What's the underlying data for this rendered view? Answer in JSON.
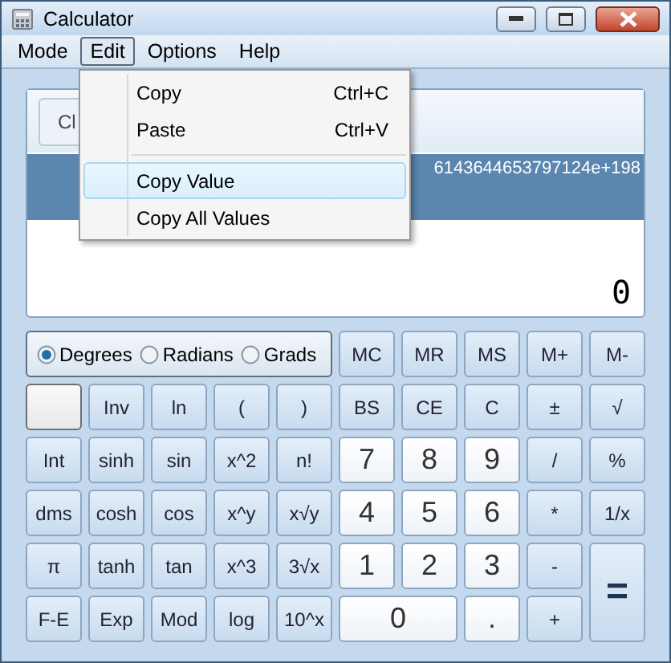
{
  "window": {
    "title": "Calculator"
  },
  "menu": [
    {
      "label": "Mode",
      "selected": false
    },
    {
      "label": "Edit",
      "selected": true
    },
    {
      "label": "Options",
      "selected": false
    },
    {
      "label": "Help",
      "selected": false
    }
  ],
  "dropdown": [
    {
      "label": "Copy",
      "shortcut": "Ctrl+C",
      "selected": false,
      "separator_after": false
    },
    {
      "label": "Paste",
      "shortcut": "Ctrl+V",
      "selected": false,
      "separator_after": true
    },
    {
      "label": "Copy Value",
      "selected": true,
      "separator_after": false
    },
    {
      "label": "Copy All Values",
      "selected": false,
      "separator_after": false
    }
  ],
  "display": {
    "clear_button": "Cl",
    "history": "6143644653797124e+198",
    "result": "0"
  },
  "angle_units": [
    {
      "label": "Degrees",
      "selected": true
    },
    {
      "label": "Radians",
      "selected": false
    },
    {
      "label": "Grads",
      "selected": false
    }
  ],
  "memory_buttons": [
    "MC",
    "MR",
    "MS",
    "M+",
    "M-"
  ],
  "buttons": [
    {
      "kind": "blank"
    },
    {
      "kind": "fn",
      "label": "Inv"
    },
    {
      "kind": "fn",
      "label": "ln"
    },
    {
      "kind": "fn",
      "label": "("
    },
    {
      "kind": "fn",
      "label": ")"
    },
    {
      "kind": "fn",
      "label": "BS"
    },
    {
      "kind": "fn",
      "label": "CE"
    },
    {
      "kind": "fn",
      "label": "C"
    },
    {
      "kind": "fn",
      "label": "±"
    },
    {
      "kind": "fn",
      "label": "√"
    },
    {
      "kind": "fn",
      "label": "Int"
    },
    {
      "kind": "fn",
      "label": "sinh"
    },
    {
      "kind": "fn",
      "label": "sin"
    },
    {
      "kind": "fn",
      "label": "x^2"
    },
    {
      "kind": "fn",
      "label": "n!"
    },
    {
      "kind": "digit",
      "label": "7"
    },
    {
      "kind": "digit",
      "label": "8"
    },
    {
      "kind": "digit",
      "label": "9"
    },
    {
      "kind": "fn",
      "label": "/"
    },
    {
      "kind": "fn",
      "label": "%"
    },
    {
      "kind": "fn",
      "label": "dms"
    },
    {
      "kind": "fn",
      "label": "cosh"
    },
    {
      "kind": "fn",
      "label": "cos"
    },
    {
      "kind": "fn",
      "label": "x^y"
    },
    {
      "kind": "fn",
      "label": "x√y"
    },
    {
      "kind": "digit",
      "label": "4"
    },
    {
      "kind": "digit",
      "label": "5"
    },
    {
      "kind": "digit",
      "label": "6"
    },
    {
      "kind": "fn",
      "label": "*"
    },
    {
      "kind": "fn",
      "label": "1/x"
    },
    {
      "kind": "fn",
      "label": "π"
    },
    {
      "kind": "fn",
      "label": "tanh"
    },
    {
      "kind": "fn",
      "label": "tan"
    },
    {
      "kind": "fn",
      "label": "x^3"
    },
    {
      "kind": "fn",
      "label": "3√x"
    },
    {
      "kind": "digit",
      "label": "1"
    },
    {
      "kind": "digit",
      "label": "2"
    },
    {
      "kind": "digit",
      "label": "3"
    },
    {
      "kind": "fn",
      "label": "-"
    },
    {
      "kind": "equals",
      "label": "="
    },
    {
      "kind": "fn",
      "label": "F-E"
    },
    {
      "kind": "fn",
      "label": "Exp"
    },
    {
      "kind": "fn",
      "label": "Mod"
    },
    {
      "kind": "fn",
      "label": "log"
    },
    {
      "kind": "fn",
      "label": "10^x"
    },
    {
      "kind": "zero",
      "label": "0"
    },
    {
      "kind": "digit",
      "label": "."
    },
    {
      "kind": "fn",
      "label": "+"
    }
  ]
}
